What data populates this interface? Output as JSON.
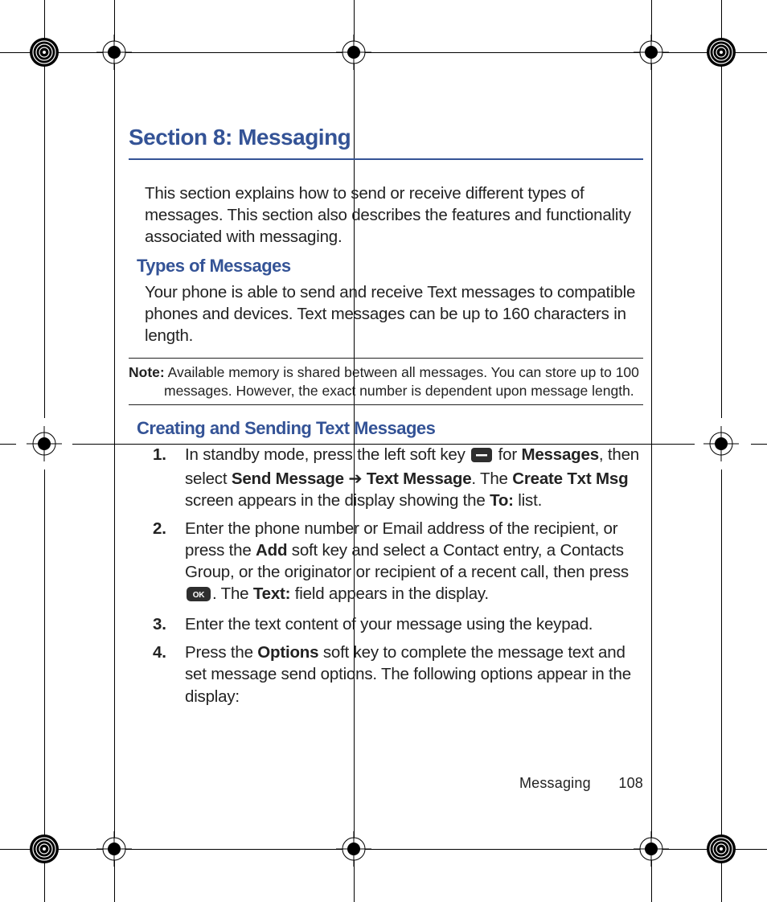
{
  "title": "Section 8: Messaging",
  "intro": "This section explains how to send or receive different types of messages. This section also describes the features and functionality associated with messaging.",
  "h2a": "Types of Messages",
  "types_body": "Your phone is able to send and receive Text messages to compatible phones and devices. Text messages can be up to 160 characters in length.",
  "note_label": "Note:",
  "note_body": "Available memory is shared between all messages. You can store up to 100 messages. However, the exact number is dependent upon message length.",
  "h2b": "Creating and Sending Text Messages",
  "steps": {
    "n1": "1.",
    "s1_a": "In standby mode, press the left soft key ",
    "s1_b": " for ",
    "s1_messages": "Messages",
    "s1_c": ", then select ",
    "s1_sendmsg": "Send Message",
    "s1_arrow": " ➔ ",
    "s1_textmsg": "Text Message",
    "s1_d": ". The ",
    "s1_create": "Create Txt Msg",
    "s1_e": " screen appears in the display showing the ",
    "s1_to": "To:",
    "s1_f": " list.",
    "n2": "2.",
    "s2_a": "Enter the phone number or Email address of the recipient, or press the ",
    "s2_add": "Add",
    "s2_b": " soft key and select a Contact entry, a Contacts Group, or the originator or recipient of a recent call, then press ",
    "s2_c": ". The ",
    "s2_text": "Text:",
    "s2_d": " field appears in the display.",
    "n3": "3.",
    "s3": "Enter the text content of your message using the keypad.",
    "n4": "4.",
    "s4_a": "Press the ",
    "s4_options": "Options",
    "s4_b": " soft key to complete the message text and set message send options. The following options appear in the display:"
  },
  "footer_label": "Messaging",
  "footer_page": "108"
}
